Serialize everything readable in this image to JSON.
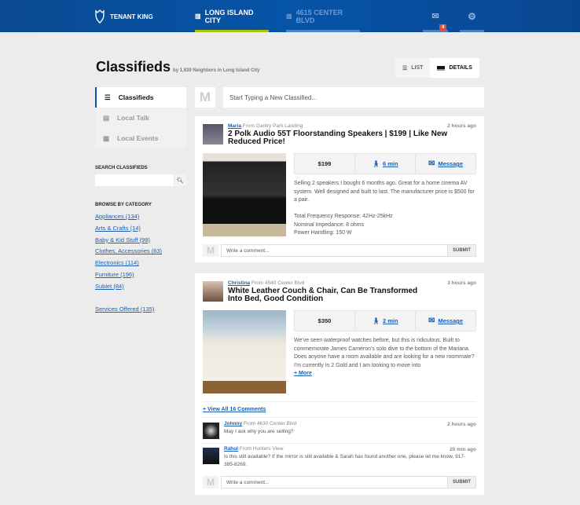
{
  "header": {
    "brand": "TENANT KING",
    "tabs": [
      {
        "label": "LONG ISLAND CITY",
        "active": true
      },
      {
        "label": "4615 CENTER BLVD",
        "active": false
      }
    ],
    "mail_badge": "4",
    "colors": {
      "active_underline": "#a8c30b",
      "accent": "#1a5fb4"
    }
  },
  "page": {
    "title": "Classifieds",
    "subtitle": "by 1,839 Neighbors in Long Island City",
    "view_list": "LIST",
    "view_details": "DETAILS"
  },
  "sidebar": {
    "nav": [
      {
        "label": "Classifieds"
      },
      {
        "label": "Local Talk"
      },
      {
        "label": "Local Events"
      }
    ],
    "search_label": "SEARCH CLASSIFIEDS",
    "search_value": "",
    "browse_label": "BROWSE BY CATEGORY",
    "categories": [
      "Appliances (134)",
      "Arts & Crafts (14)",
      "Baby & Kid Stuff (98)",
      "Clothes, Accessories (63)",
      "Electronics (114)",
      "Furniture (196)",
      "Sublet (84)"
    ],
    "services": "Services Offered (135)"
  },
  "composer": {
    "icon_letter": "M",
    "placeholder": "Start Typing a New Classified..."
  },
  "posts": [
    {
      "author": "Maria",
      "from": "From Gantry Park Landing",
      "time": "2 hours ago",
      "title": "2 Polk Audio 55T Floorstanding Speakers | $199 | Like New Reduced Price!",
      "price": "$199",
      "walk": "6 min",
      "message": "Message",
      "desc": [
        "Selling 2 speakers I bought 6 months ago. Great for a home cinema AV system. Well designed and built to last. The manufacturer price is $500 for a pair.",
        "Total Frequency Response: 42Hz-25kHz",
        "Nominal Impedance: 8 ohms",
        "Power Handling: 150 W"
      ],
      "comment_placeholder": "Write a comment...",
      "submit": "SUBMIT"
    },
    {
      "author": "Christina",
      "from": "From 4540 Center Blvd",
      "time": "3 hours ago",
      "title": "White Leather Couch & Chair, Can Be Transformed Into Bed, Good Condition",
      "price": "$350",
      "walk": "2 min",
      "message": "Message",
      "desc": [
        "We've seen waterproof watches before, but this is ridiculous. Built to commemorate James Cameron's solo dive to the bottom of the Mariana.",
        "Does anyone have a room available and are looking for a new roommate? I'm currently in 2 Gold and I am looking to move into"
      ],
      "more": "+ More",
      "view_all": "+ View All 16 Comments",
      "comments": [
        {
          "author": "Johnny",
          "from": "From 4630 Center Blvd",
          "time": "2 hours ago",
          "text": "May I ask why you are selling?"
        },
        {
          "author": "Rahul",
          "from": "From Hunters View",
          "time": "20 min ago",
          "text": "Is this still available? If the mirror is still available & Sarah has found another one, please let me know, 917-385-8269."
        }
      ],
      "comment_placeholder": "Write a comment...",
      "submit": "SUBMIT"
    }
  ]
}
